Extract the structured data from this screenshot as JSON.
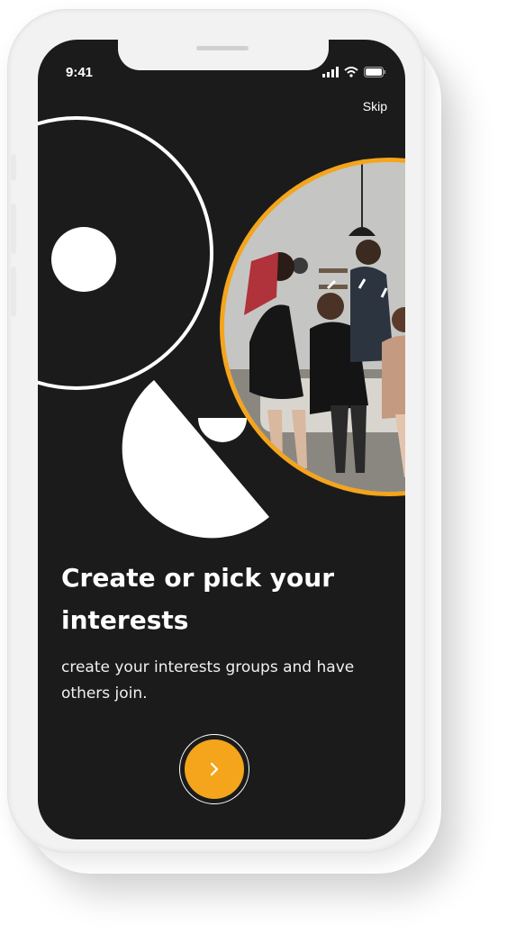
{
  "status_bar": {
    "time": "9:41",
    "icons": [
      "signal-icon",
      "wifi-icon",
      "battery-icon"
    ]
  },
  "header": {
    "skip_label": "Skip"
  },
  "onboarding": {
    "title": "Create or pick your interests",
    "subtitle": "create your interests groups and have others join.",
    "next_icon": "chevron-right-icon"
  },
  "colors": {
    "screen_background": "#1b1b1b",
    "accent": "#f4a51c",
    "text": "#ffffff",
    "device_frame": "#f2f2f2"
  }
}
